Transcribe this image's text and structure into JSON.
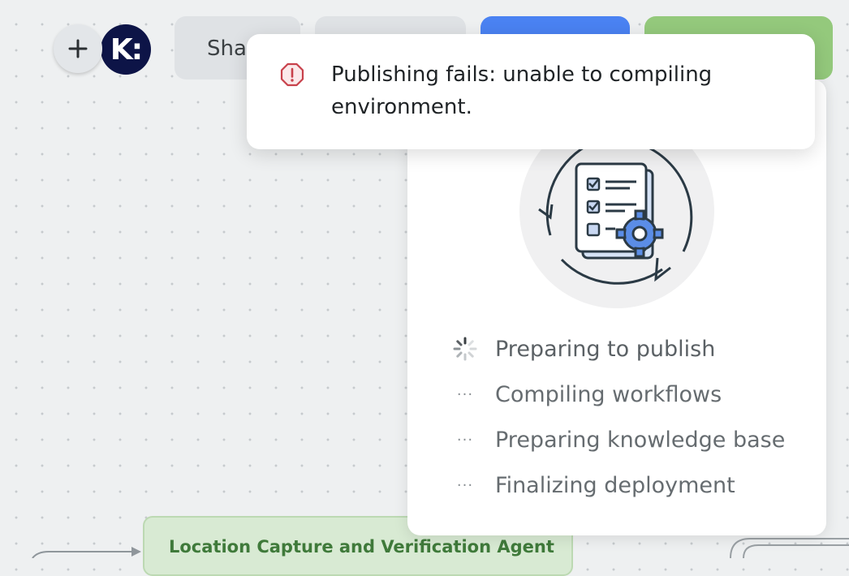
{
  "toolbar": {
    "add_icon": "plus-icon",
    "logo_text": "K:",
    "share_label": "Sha"
  },
  "toast": {
    "icon": "alert-octagon-icon",
    "message": "Publishing fails: unable to compiling environment.",
    "accent_color": "#c8414b"
  },
  "publish_panel": {
    "illustration_icon": "checklist-gear-cycle-icon",
    "steps": [
      {
        "label": "Preparing to publish",
        "status": "in-progress",
        "icon": "spinner-icon"
      },
      {
        "label": "Compiling workflows",
        "status": "pending",
        "icon": "ellipsis-icon"
      },
      {
        "label": "Preparing knowledge base",
        "status": "pending",
        "icon": "ellipsis-icon"
      },
      {
        "label": "Finalizing deployment",
        "status": "pending",
        "icon": "ellipsis-icon"
      }
    ]
  },
  "canvas": {
    "node_title": "Location Capture and Verification Agent"
  },
  "colors": {
    "blue_button": "#4a82f2",
    "green_button": "#94c97c",
    "logo_bg": "#0d1447",
    "node_bg": "#d8ead3"
  }
}
